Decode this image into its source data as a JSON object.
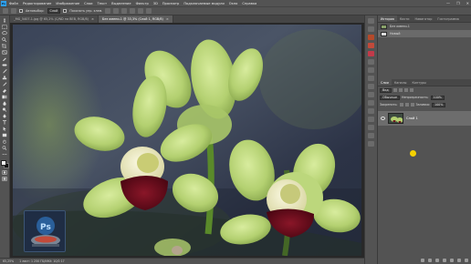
{
  "app": {
    "logo_text": "Ps"
  },
  "menu": [
    "Файл",
    "Редактирование",
    "Изображение",
    "Слои",
    "Текст",
    "Выделение",
    "Фильтр",
    "3D",
    "Просмотр",
    "Подключаемые модули",
    "Окно",
    "Справка"
  ],
  "window_controls": [
    "—",
    "❐",
    "✕"
  ],
  "options_bar": {
    "autoselect_label": "Автовыбор:",
    "autoselect_value": "Слой",
    "transform_label": "Показать упр. элем."
  },
  "tabs": [
    {
      "label": "_MG_5407-1.jpg @ 65,2% (С/ND на ВЕВ, RGB/8)",
      "active": false
    },
    {
      "label": "Без имени-1 @ 33,3% (Слой 1, RGB/8)",
      "active": true
    }
  ],
  "status": {
    "zoom": "65,25%",
    "doc_info": "1 лист: 1 250 ГБ/ИНХ: 10/0 17"
  },
  "panels": {
    "history_tabs": [
      "История",
      "Кисти",
      "Навигатор",
      "Гистограмма"
    ],
    "history_items": [
      {
        "label": "Без имени-1",
        "selected": false
      },
      {
        "label": "Новый",
        "selected": true
      }
    ],
    "layers_tabs": [
      "Слои",
      "Каналы",
      "Контуры"
    ],
    "layers_filter": "Вид",
    "blend_mode": "Обычные",
    "opacity_label": "Непрозрачность:",
    "opacity_value": "100%",
    "lock_label": "Закрепить:",
    "fill_label": "Заливка:",
    "fill_value": "100%",
    "layer": {
      "name": "Слой 1"
    }
  },
  "colors": {
    "ui_gray": "#535353",
    "accent_yellow": "#f5d100",
    "flower_green": "#b8d37a",
    "lip_red": "#6b0f1e"
  }
}
